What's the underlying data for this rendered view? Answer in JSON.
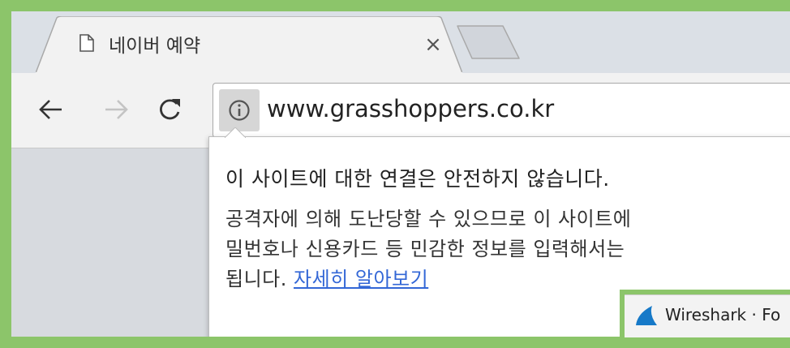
{
  "tab": {
    "title": "네이버 예약",
    "close_glyph": "×",
    "icon": "document-icon"
  },
  "toolbar": {
    "back_icon": "back-arrow-icon",
    "forward_icon": "forward-arrow-icon",
    "reload_icon": "reload-icon"
  },
  "omnibox": {
    "security_icon": "info-icon",
    "url": "www.grasshoppers.co.kr"
  },
  "popup": {
    "heading": "이 사이트에 대한 연결은 안전하지 않습니다.",
    "body_lines": [
      "공격자에 의해 도난당할 수 있으므로 이 사이트에",
      "밀번호나 신용카드 등 민감한 정보를 입력해서는",
      "됩니다."
    ],
    "learn_more": "자세히 알아보기"
  },
  "taskbar": {
    "app_icon": "wireshark-fin-icon",
    "label": "Wireshark · Fo"
  },
  "colors": {
    "frame_border": "#8cc56a",
    "link": "#3367d6",
    "tabstrip": "#dbe0e6",
    "toolbar": "#f2f2f2"
  }
}
